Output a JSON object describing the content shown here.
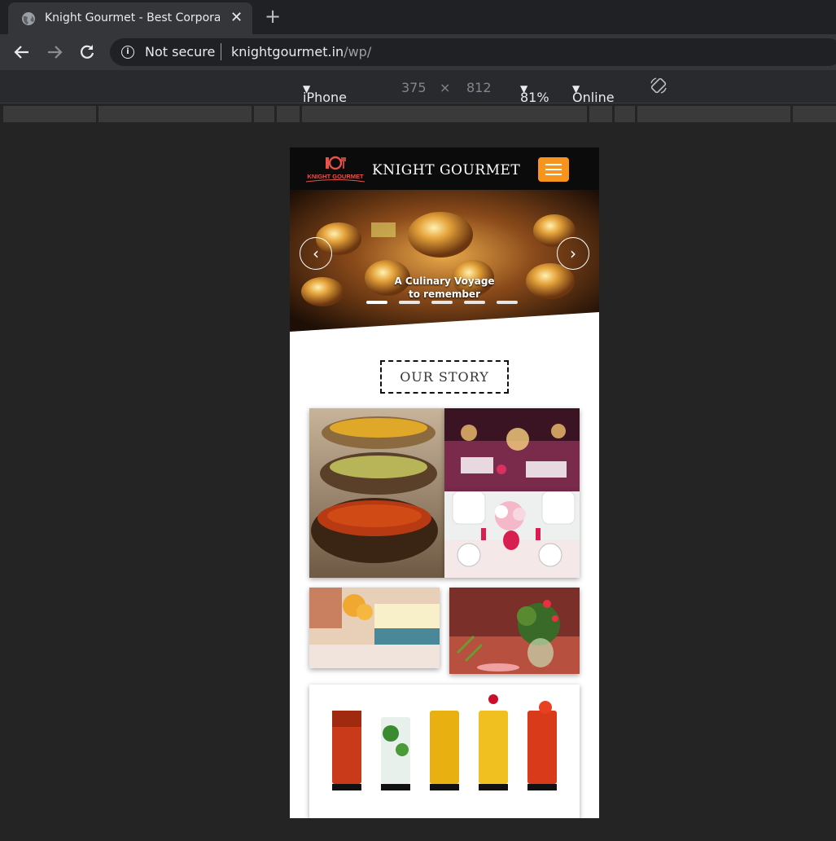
{
  "browser": {
    "tab_title": "Knight Gourmet - Best Corporate",
    "tab_close": "✕",
    "new_tab": "+",
    "security": "Not secure",
    "url_host": "knightgourmet.in",
    "url_path": "/wp/"
  },
  "device_toolbar": {
    "device": "iPhone X",
    "width": "375",
    "times": "×",
    "height": "812",
    "zoom": "81%",
    "network": "Online"
  },
  "site": {
    "logo_text": "KNIGHT GOURMET",
    "brand": "KNIGHT GOURMET",
    "hero_caption_line1": "A Culinary Voyage",
    "hero_caption_line2": "to remember",
    "section_title": "OUR STORY"
  }
}
